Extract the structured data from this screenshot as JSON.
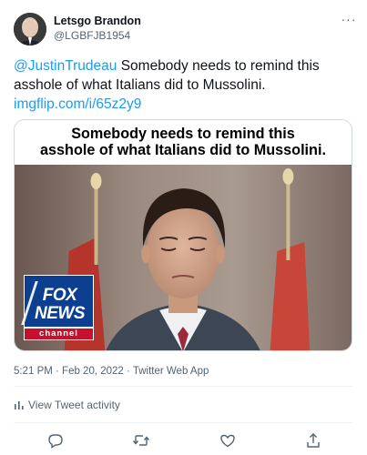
{
  "user": {
    "display_name": "Letsgo Brandon",
    "handle": "@LGBFJB1954"
  },
  "menu_icon": "more-horizontal-icon",
  "tweet": {
    "mention": "@JustinTrudeau",
    "body": " Somebody needs to remind this asshole of what Italians did to Mussolini.",
    "link": "imgflip.com/i/65z2y9"
  },
  "media": {
    "caption_line1": "Somebody needs to remind this",
    "caption_line2": "asshole of what Italians did to Mussolini.",
    "logo_line1": "FOX",
    "logo_line2": "NEWS",
    "logo_line3": "channel"
  },
  "meta": {
    "timestamp": "5:21 PM · Feb 20, 2022 · Twitter Web App"
  },
  "activity": {
    "label": "View Tweet activity",
    "icon": "bar-chart-icon"
  },
  "actions": {
    "reply_icon": "reply-icon",
    "retweet_icon": "retweet-icon",
    "like_icon": "like-icon",
    "share_icon": "share-icon"
  },
  "colors": {
    "link": "#1d9bf0",
    "secondary_text": "#536471",
    "primary_text": "#0f1419",
    "fox_blue": "#0c3f8f",
    "fox_red": "#c8102e"
  }
}
